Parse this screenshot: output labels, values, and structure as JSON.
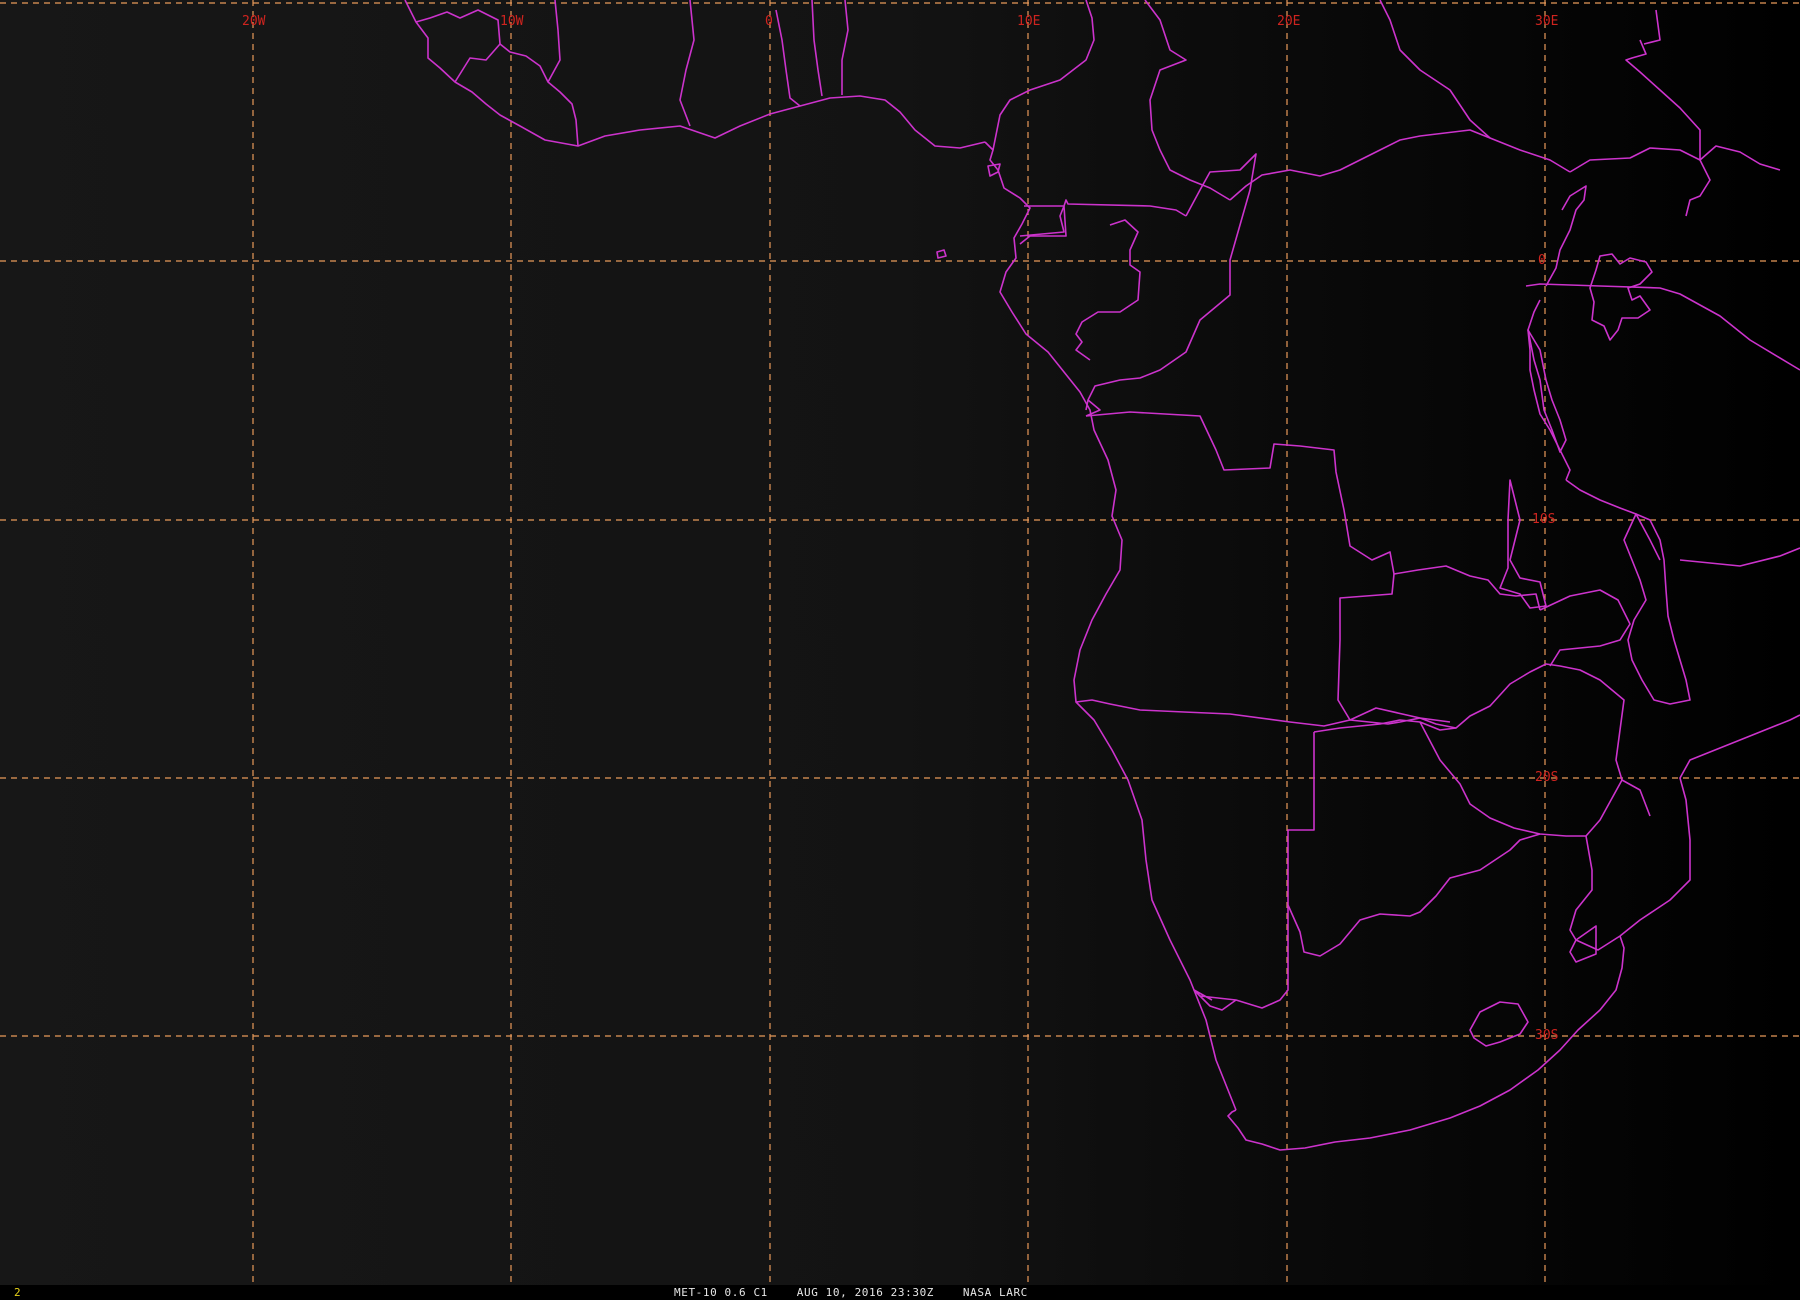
{
  "map": {
    "title": "MET-10 0.6 C1",
    "lon_labels": [
      "20W",
      "10W",
      "0",
      "10E",
      "20E",
      "30E"
    ],
    "lat_labels": [
      "0",
      "10S",
      "20S",
      "30S"
    ],
    "border_color": "#cc33cc",
    "grid_color": "#e89a5a",
    "label_color": "#d0241f",
    "background": "#141414"
  },
  "status_bar": {
    "frame_number": "2",
    "text": "MET-10 0.6 C1    AUG 10, 2016 23:30Z    NASA LARC"
  }
}
